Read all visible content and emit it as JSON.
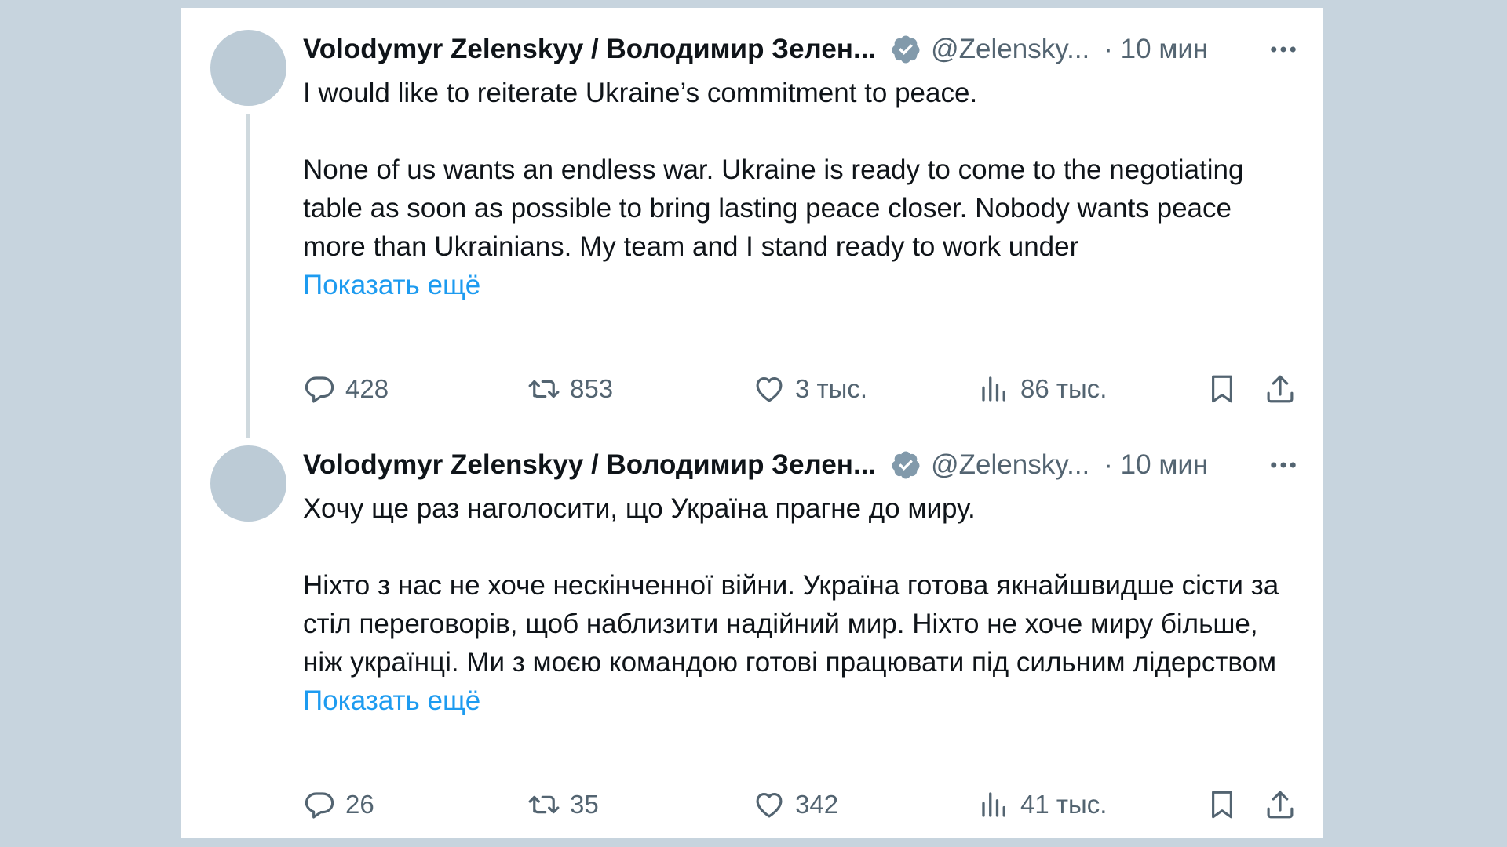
{
  "tweets": [
    {
      "author_name": "Volodymyr Zelenskyy / Володимир Зелен...",
      "handle": "@Zelensky...",
      "time": "· 10 мин",
      "paragraph1": "I would like to reiterate Ukraine’s commitment to peace.",
      "paragraph2": "None of us wants an endless war. Ukraine is ready to come to the negotiating table as soon as possible to bring lasting peace closer. Nobody wants peace more than Ukrainians. My team and I stand ready to work under",
      "show_more": "Показать ещё",
      "replies": "428",
      "retweets": "853",
      "likes": "3 тыс.",
      "views": "86 тыс."
    },
    {
      "author_name": "Volodymyr Zelenskyy / Володимир Зелен...",
      "handle": "@Zelensky...",
      "time": "· 10 мин",
      "paragraph1": "Хочу ще раз наголосити, що Україна прагне до миру.",
      "paragraph2": "Ніхто з нас не хоче нескінченної війни. Україна готова якнайшвидше сісти за стіл переговорів, щоб наблизити надійний мир. Ніхто не хоче миру більше, ніж українці. Ми з моєю командою готові працювати під сильним лідерством",
      "show_more": "Показать ещё",
      "replies": "26",
      "retweets": "35",
      "likes": "342",
      "views": "41 тыс."
    }
  ],
  "icons": [
    "reply-icon",
    "retweet-icon",
    "like-icon",
    "views-icon",
    "bookmark-icon",
    "share-icon",
    "more-icon",
    "verified-icon"
  ],
  "colors": {
    "background": "#c7d4de",
    "card": "#ffffff",
    "text": "#0f1419",
    "muted": "#536471",
    "link": "#1d9bf0",
    "verified": "#829aab"
  }
}
